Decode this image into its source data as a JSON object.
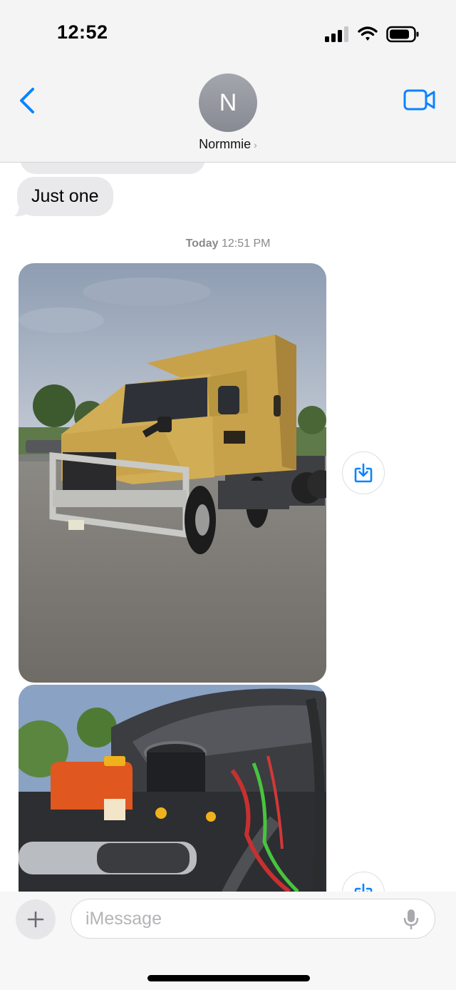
{
  "status_bar": {
    "time": "12:52"
  },
  "header": {
    "contact_initial": "N",
    "contact_name": "Normmie",
    "contact_chevron": "›"
  },
  "thread": {
    "messages": [
      {
        "type": "text",
        "from": "contact",
        "text": "Just one"
      }
    ],
    "timestamp_day": "Today",
    "timestamp_time": "12:51 PM",
    "photos": [
      {
        "subject": "gold semi truck cab parked in lot"
      },
      {
        "subject": "truck engine compartment"
      }
    ]
  },
  "composer": {
    "placeholder": "iMessage"
  },
  "colors": {
    "accent": "#0a84ff",
    "bubble_gray": "#e9e9eb"
  }
}
